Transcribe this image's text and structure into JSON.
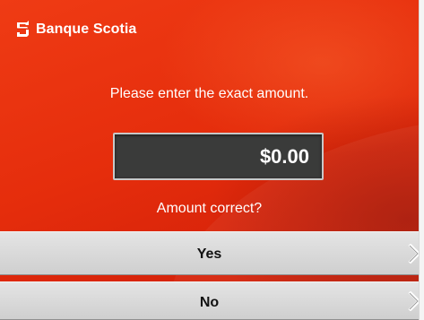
{
  "brand": {
    "name": "Banque Scotia",
    "logo_icon": "scotiabank-s-logo-icon"
  },
  "prompt": "Please enter the exact amount.",
  "amount": {
    "value": "$0.00"
  },
  "confirmation": {
    "question": "Amount correct?"
  },
  "buttons": {
    "yes_label": "Yes",
    "no_label": "No",
    "arrow_icon": "chevron-right-icon"
  },
  "colors": {
    "background_red": "#e52d0c",
    "amount_box": "#3a3b3a",
    "button_gray": "#d9d9d9",
    "text_white": "#ffffff"
  }
}
